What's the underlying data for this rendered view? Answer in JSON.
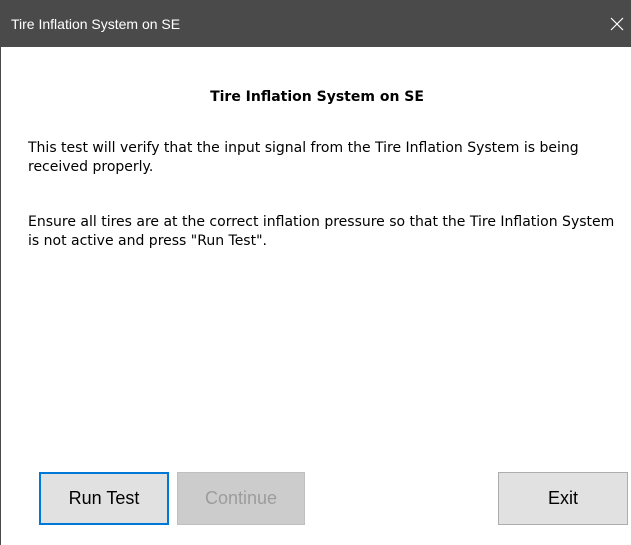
{
  "window": {
    "title": "Tire Inflation System on SE"
  },
  "content": {
    "heading": "Tire Inflation System on SE",
    "paragraph1": "This test will verify that the input signal from the Tire Inflation System is being received properly.",
    "paragraph2": "Ensure all tires are at the correct inflation pressure so that the Tire Inflation System is not active and press \"Run Test\"."
  },
  "buttons": {
    "run_test": "Run Test",
    "continue": "Continue",
    "exit": "Exit"
  },
  "icons": {
    "close": "close-icon"
  },
  "colors": {
    "titlebar": "#4a4a4a",
    "focus_border": "#0078d7",
    "button_face": "#e1e1e1",
    "disabled_text": "#9c9c9c"
  }
}
